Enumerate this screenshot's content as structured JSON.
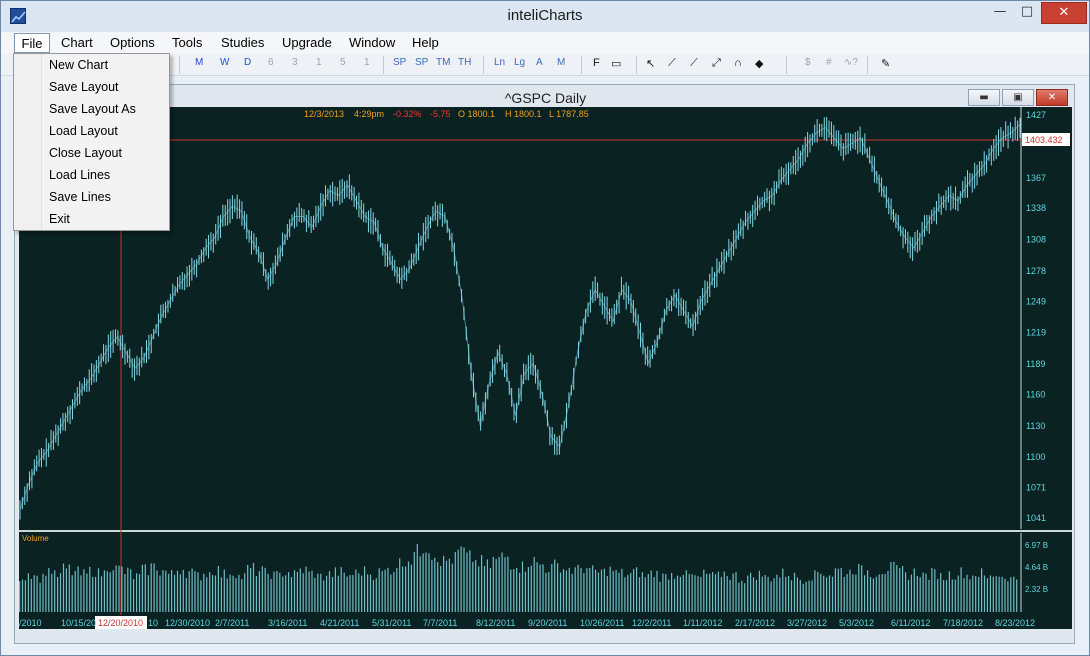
{
  "window": {
    "title": "inteliCharts",
    "min": "—",
    "max": "□",
    "close": "✕"
  },
  "menubar": [
    "File",
    "Chart",
    "Options",
    "Tools",
    "Studies",
    "Upgrade",
    "Window",
    "Help"
  ],
  "file_menu": [
    "New Chart",
    "Save Layout",
    "Save Layout As",
    "Load Layout",
    "Close Layout",
    "Load Lines",
    "Save Lines",
    "Exit"
  ],
  "toolbar": {
    "periods": [
      "M",
      "W",
      "D",
      "6",
      "3",
      "1",
      "5",
      "1"
    ],
    "scales": [
      "SP",
      "SP",
      "TM",
      "TH"
    ],
    "axes": [
      "Ln",
      "Lg",
      "A",
      "M"
    ],
    "f_label": "F",
    "misc": [
      "$",
      "#"
    ]
  },
  "chart_window": {
    "title": "^GSPC Daily",
    "min": "▬",
    "max": "▣",
    "close": "✕"
  },
  "quote": {
    "date": "12/3/2013",
    "time": "4:29pm",
    "pct": "-0.32%",
    "chg": "-5.75",
    "open": "O 1800.1",
    "high": "H 1800.1",
    "low": "L 1787.85"
  },
  "crosshair_price": "1403.432",
  "crosshair_date": "12/20/2010",
  "volume_label": "Volume",
  "colors": {
    "bg": "#0b2222",
    "bars": "#7fd8e6",
    "axis_text": "#5fd6e0",
    "quote": "#f0a020",
    "crosshair": "#d23a2a"
  },
  "chart_data": {
    "type": "line",
    "title": "^GSPC Daily",
    "y_ticks": [
      "1427",
      "1367",
      "1338",
      "1308",
      "1278",
      "1249",
      "1219",
      "1189",
      "1160",
      "1130",
      "1100",
      "1071",
      "1041"
    ],
    "x_ticks": [
      "/2010",
      "10/15/20",
      "10",
      "12/30/2010",
      "2/7/2011",
      "3/16/2011",
      "4/21/2011",
      "5/31/2011",
      "7/7/2011",
      "8/12/2011",
      "9/20/2011",
      "10/26/2011",
      "12/2/2011",
      "1/11/2012",
      "2/17/2012",
      "3/27/2012",
      "5/3/2012",
      "6/11/2012",
      "7/18/2012",
      "8/23/2012"
    ],
    "volume_ticks": [
      "6.97 B",
      "4.64 B",
      "2.32 B"
    ],
    "ylim": [
      1041,
      1427
    ],
    "series": [
      {
        "values": [
          1050,
          1075,
          1095,
          1105,
          1120,
          1135,
          1150,
          1165,
          1175,
          1190,
          1205,
          1215,
          1200,
          1185,
          1195,
          1215,
          1235,
          1250,
          1265,
          1275,
          1285,
          1300,
          1310,
          1330,
          1340,
          1335,
          1310,
          1295,
          1270,
          1285,
          1310,
          1330,
          1330,
          1320,
          1340,
          1355,
          1350,
          1360,
          1345,
          1330,
          1325,
          1300,
          1285,
          1270,
          1280,
          1300,
          1320,
          1335,
          1330,
          1300,
          1250,
          1180,
          1130,
          1170,
          1200,
          1180,
          1140,
          1180,
          1190,
          1160,
          1120,
          1110,
          1150,
          1200,
          1240,
          1260,
          1245,
          1230,
          1260,
          1250,
          1220,
          1190,
          1210,
          1240,
          1255,
          1240,
          1225,
          1250,
          1265,
          1280,
          1295,
          1310,
          1325,
          1335,
          1345,
          1350,
          1365,
          1375,
          1385,
          1400,
          1410,
          1415,
          1405,
          1395,
          1400,
          1405,
          1385,
          1365,
          1345,
          1325,
          1310,
          1300,
          1315,
          1330,
          1340,
          1350,
          1345,
          1360,
          1370,
          1380,
          1395,
          1405,
          1410,
          1418
        ]
      }
    ],
    "volume": [
      3.2,
      3.5,
      3.1,
      3.8,
      3.3,
      3.9,
      3.6,
      3.4,
      3.7,
      3.5,
      4.2,
      3.9,
      3.6,
      3.2,
      3.8,
      4.1,
      3.7,
      3.4,
      3.9,
      3.6,
      3.3,
      3.5,
      3.8,
      3.4,
      3.6,
      3.2,
      3.9,
      3.7,
      3.5,
      3.3,
      3.6,
      3.4,
      3.8,
      3.5,
      3.2,
      3.4,
      3.6,
      3.3,
      3.5,
      3.7,
      3.4,
      3.6,
      3.9,
      4.4,
      4.8,
      5.4,
      6.0,
      5.2,
      4.6,
      4.8,
      5.5,
      4.9,
      4.5,
      4.2,
      4.7,
      5.0,
      4.4,
      4.1,
      4.6,
      4.3,
      4.0,
      4.2,
      3.9,
      3.8,
      4.0,
      3.7,
      3.6,
      3.8,
      3.5,
      3.4,
      3.6,
      3.3,
      3.5,
      3.2,
      3.4,
      3.6,
      3.3,
      3.1,
      3.4,
      3.2,
      3.5,
      3.3,
      3.0,
      3.2,
      3.4,
      3.1,
      3.3,
      3.5,
      3.2,
      3.0,
      3.3,
      3.6,
      3.4,
      3.8,
      3.6,
      3.9,
      3.7,
      3.5,
      3.8,
      4.0,
      3.7,
      3.4,
      3.6,
      3.3,
      3.5,
      3.2,
      3.4,
      3.6,
      3.3,
      3.5,
      3.1,
      3.4,
      3.2,
      3.0
    ]
  }
}
